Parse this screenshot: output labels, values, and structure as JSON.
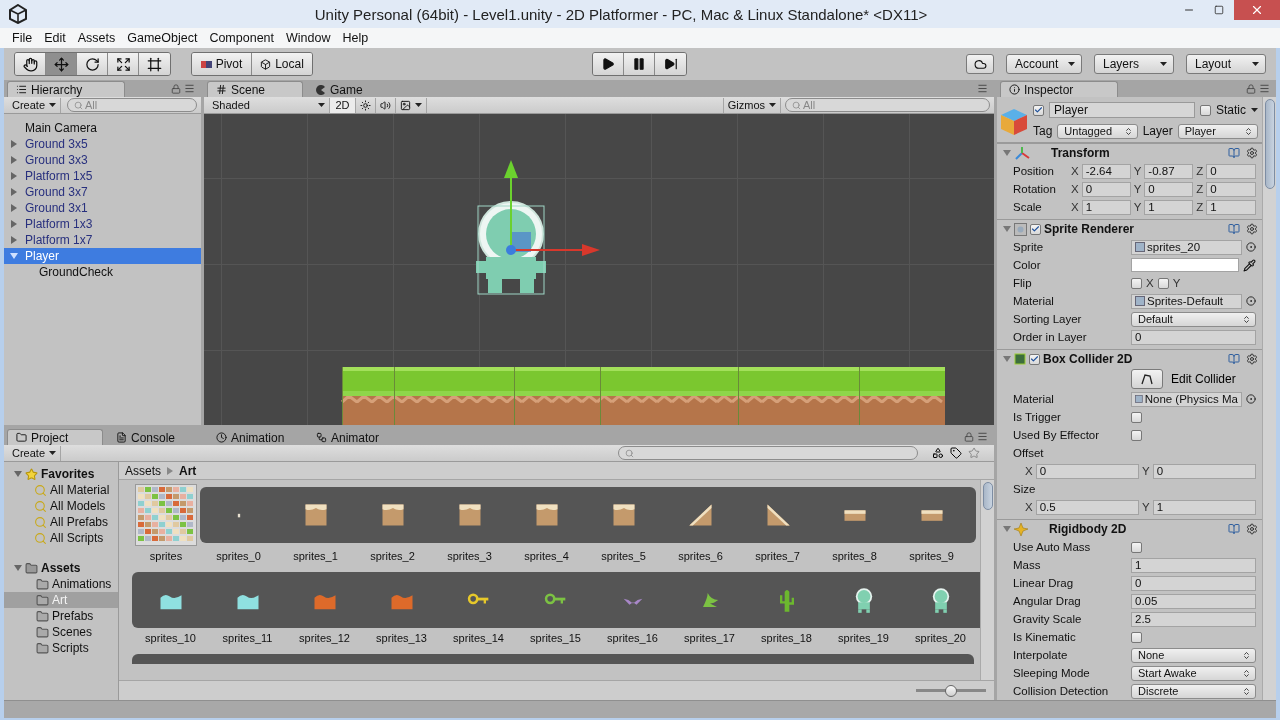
{
  "window": {
    "title": "Unity Personal (64bit) - Level1.unity - 2D Platformer - PC, Mac & Linux Standalone* <DX11>"
  },
  "menu": [
    "File",
    "Edit",
    "Assets",
    "GameObject",
    "Component",
    "Window",
    "Help"
  ],
  "toolbar": {
    "tools": [
      {
        "kind": "hand",
        "selected": false
      },
      {
        "kind": "move",
        "selected": true
      },
      {
        "kind": "rotate",
        "selected": false
      },
      {
        "kind": "scale",
        "selected": false
      },
      {
        "kind": "rect",
        "selected": false
      }
    ],
    "handle_buttons": [
      {
        "kind": "pivot",
        "label": "Pivot"
      },
      {
        "kind": "local",
        "label": "Local"
      }
    ],
    "playback": [
      {
        "kind": "play",
        "selected": false
      },
      {
        "kind": "pause",
        "selected": false
      },
      {
        "kind": "step",
        "selected": false
      }
    ],
    "account": "Account",
    "layers": "Layers",
    "layout": "Layout"
  },
  "hierarchy": {
    "tab": "Hierarchy",
    "create": "Create",
    "search": {
      "placeholder": "All"
    },
    "items": [
      {
        "label": "Main Camera",
        "kind": "object",
        "selected": false
      },
      {
        "label": "Ground 3x5",
        "kind": "prefab",
        "expanded": false,
        "selected": false
      },
      {
        "label": "Ground 3x3",
        "kind": "prefab",
        "expanded": false,
        "selected": false
      },
      {
        "label": "Platform 1x5",
        "kind": "prefab",
        "expanded": false,
        "selected": false
      },
      {
        "label": "Ground 3x7",
        "kind": "prefab",
        "expanded": false,
        "selected": false
      },
      {
        "label": "Ground 3x1",
        "kind": "prefab",
        "expanded": false,
        "selected": false
      },
      {
        "label": "Platform 1x3",
        "kind": "prefab",
        "expanded": false,
        "selected": false
      },
      {
        "label": "Platform 1x7",
        "kind": "prefab",
        "expanded": false,
        "selected": false
      },
      {
        "label": "Player",
        "kind": "object",
        "expanded": true,
        "selected": true,
        "children": [
          {
            "label": "GroundCheck",
            "kind": "object",
            "selected": false
          }
        ]
      }
    ]
  },
  "scene": {
    "tabs": [
      {
        "label": "Scene",
        "kind": "scene",
        "selected": true
      },
      {
        "label": "Game",
        "kind": "game",
        "selected": false
      }
    ],
    "shading": "Shaded",
    "mode_2d": {
      "label": "2D",
      "on": true
    },
    "gizmos": "Gizmos",
    "search": {
      "placeholder": "All"
    }
  },
  "inspector": {
    "tab": "Inspector",
    "object": {
      "active": true,
      "name": "Player",
      "static": {
        "label": "Static",
        "checked": false
      },
      "tag_label": "Tag",
      "tag": "Untagged",
      "layer_label": "Layer",
      "layer": "Player"
    },
    "components": [
      {
        "kind": "transform",
        "name": "Transform",
        "expanded": true,
        "rows": [
          {
            "kind": "vector3",
            "label": "Position",
            "values": [
              {
                "axis": "X",
                "value": "-2.64"
              },
              {
                "axis": "Y",
                "value": "-0.87"
              },
              {
                "axis": "Z",
                "value": "0"
              }
            ]
          },
          {
            "kind": "vector3",
            "label": "Rotation",
            "values": [
              {
                "axis": "X",
                "value": "0"
              },
              {
                "axis": "Y",
                "value": "0"
              },
              {
                "axis": "Z",
                "value": "0"
              }
            ]
          },
          {
            "kind": "vector3",
            "label": "Scale",
            "values": [
              {
                "axis": "X",
                "value": "1"
              },
              {
                "axis": "Y",
                "value": "1"
              },
              {
                "axis": "Z",
                "value": "1"
              }
            ]
          }
        ]
      },
      {
        "kind": "sprite-renderer",
        "name": "Sprite Renderer",
        "expanded": true,
        "enabled": true,
        "rows": [
          {
            "kind": "object",
            "label": "Sprite",
            "value": "sprites_20"
          },
          {
            "kind": "color",
            "label": "Color",
            "color": "#ffffff"
          },
          {
            "kind": "flip",
            "label": "Flip",
            "options": [
              {
                "label": "X",
                "checked": false
              },
              {
                "label": "Y",
                "checked": false
              }
            ]
          },
          {
            "kind": "object",
            "label": "Material",
            "value": "Sprites-Default"
          },
          {
            "kind": "dropdown",
            "label": "Sorting Layer",
            "value": "Default"
          },
          {
            "kind": "text",
            "label": "Order in Layer",
            "value": "0"
          }
        ]
      },
      {
        "kind": "box-collider",
        "name": "Box Collider 2D",
        "expanded": true,
        "enabled": true,
        "rows": [
          {
            "kind": "button",
            "label": "Edit Collider"
          },
          {
            "kind": "object",
            "label": "Material",
            "value": "None (Physics Ma"
          },
          {
            "kind": "checkbox",
            "label": "Is Trigger",
            "checked": false
          },
          {
            "kind": "checkbox",
            "label": "Used By Effector",
            "checked": false
          },
          {
            "kind": "vector2",
            "label": "Offset",
            "values": [
              {
                "axis": "X",
                "value": "0"
              },
              {
                "axis": "Y",
                "value": "0"
              }
            ]
          },
          {
            "kind": "vector2",
            "label": "Size",
            "values": [
              {
                "axis": "X",
                "value": "0.5"
              },
              {
                "axis": "Y",
                "value": "1"
              }
            ]
          }
        ]
      },
      {
        "kind": "rigidbody",
        "name": "Rigidbody 2D",
        "expanded": true,
        "rows": [
          {
            "kind": "checkbox",
            "label": "Use Auto Mass",
            "checked": false
          },
          {
            "kind": "text",
            "label": "Mass",
            "value": "1"
          },
          {
            "kind": "text",
            "label": "Linear Drag",
            "value": "0"
          },
          {
            "kind": "text",
            "label": "Angular Drag",
            "value": "0.05"
          },
          {
            "kind": "text",
            "label": "Gravity Scale",
            "value": "2.5"
          },
          {
            "kind": "checkbox",
            "label": "Is Kinematic",
            "checked": false
          },
          {
            "kind": "dropdown",
            "label": "Interpolate",
            "value": "None"
          },
          {
            "kind": "dropdown",
            "label": "Sleeping Mode",
            "value": "Start Awake"
          },
          {
            "kind": "dropdown",
            "label": "Collision Detection",
            "value": "Discrete"
          }
        ]
      }
    ]
  },
  "project": {
    "tabs": [
      {
        "label": "Project",
        "kind": "project",
        "selected": true
      },
      {
        "label": "Console",
        "kind": "console",
        "selected": false
      },
      {
        "label": "Animation",
        "kind": "animation",
        "selected": false
      },
      {
        "label": "Animator",
        "kind": "animator",
        "selected": false
      }
    ],
    "create": "Create",
    "favorites": {
      "label": "Favorites",
      "expanded": true,
      "items": [
        {
          "label": "All Material",
          "selected": false
        },
        {
          "label": "All Models",
          "selected": false
        },
        {
          "label": "All Prefabs",
          "selected": false
        },
        {
          "label": "All Scripts",
          "selected": false
        }
      ]
    },
    "assets": {
      "label": "Assets",
      "expanded": true,
      "children": [
        {
          "label": "Animations",
          "selected": false
        },
        {
          "label": "Art",
          "selected": true
        },
        {
          "label": "Prefabs",
          "selected": false
        },
        {
          "label": "Scenes",
          "selected": false
        },
        {
          "label": "Scripts",
          "selected": false
        }
      ]
    },
    "breadcrumb": [
      "Assets",
      "Art"
    ],
    "sprite_sheet": {
      "label": "sprites"
    },
    "sprite_rows": [
      {
        "items": [
          {
            "label": "sprites_0",
            "kind": "dot",
            "color": "#e8e0d0"
          },
          {
            "label": "sprites_1",
            "kind": "block",
            "color": "#c49a6c"
          },
          {
            "label": "sprites_2",
            "kind": "block",
            "color": "#c49a6c"
          },
          {
            "label": "sprites_3",
            "kind": "block",
            "color": "#c49a6c"
          },
          {
            "label": "sprites_4",
            "kind": "block",
            "color": "#c49a6c"
          },
          {
            "label": "sprites_5",
            "kind": "block",
            "color": "#c49a6c"
          },
          {
            "label": "sprites_6",
            "kind": "slope-up",
            "color": "#c49a6c"
          },
          {
            "label": "sprites_7",
            "kind": "slope-down",
            "color": "#c49a6c"
          },
          {
            "label": "sprites_8",
            "kind": "slab",
            "color": "#c49a6c"
          },
          {
            "label": "sprites_9",
            "kind": "slab",
            "color": "#c49a6c"
          }
        ]
      },
      {
        "items": [
          {
            "label": "sprites_10",
            "kind": "wave",
            "color": "#8fe0e0"
          },
          {
            "label": "sprites_11",
            "kind": "wave",
            "color": "#8fe0e0"
          },
          {
            "label": "sprites_12",
            "kind": "wave",
            "color": "#dd6a2a"
          },
          {
            "label": "sprites_13",
            "kind": "wave",
            "color": "#dd6a2a"
          },
          {
            "label": "sprites_14",
            "kind": "key",
            "color": "#e6c82a"
          },
          {
            "label": "sprites_15",
            "kind": "key",
            "color": "#7cc243"
          },
          {
            "label": "sprites_16",
            "kind": "bat",
            "color": "#a887c8"
          },
          {
            "label": "sprites_17",
            "kind": "plant",
            "color": "#7cc243"
          },
          {
            "label": "sprites_18",
            "kind": "cactus",
            "color": "#6cb82e"
          },
          {
            "label": "sprites_19",
            "kind": "alien",
            "color": "#80d0b0"
          },
          {
            "label": "sprites_20",
            "kind": "alien",
            "color": "#80d0b0"
          }
        ]
      }
    ],
    "zoom_slider": {
      "level": 0.5
    }
  }
}
